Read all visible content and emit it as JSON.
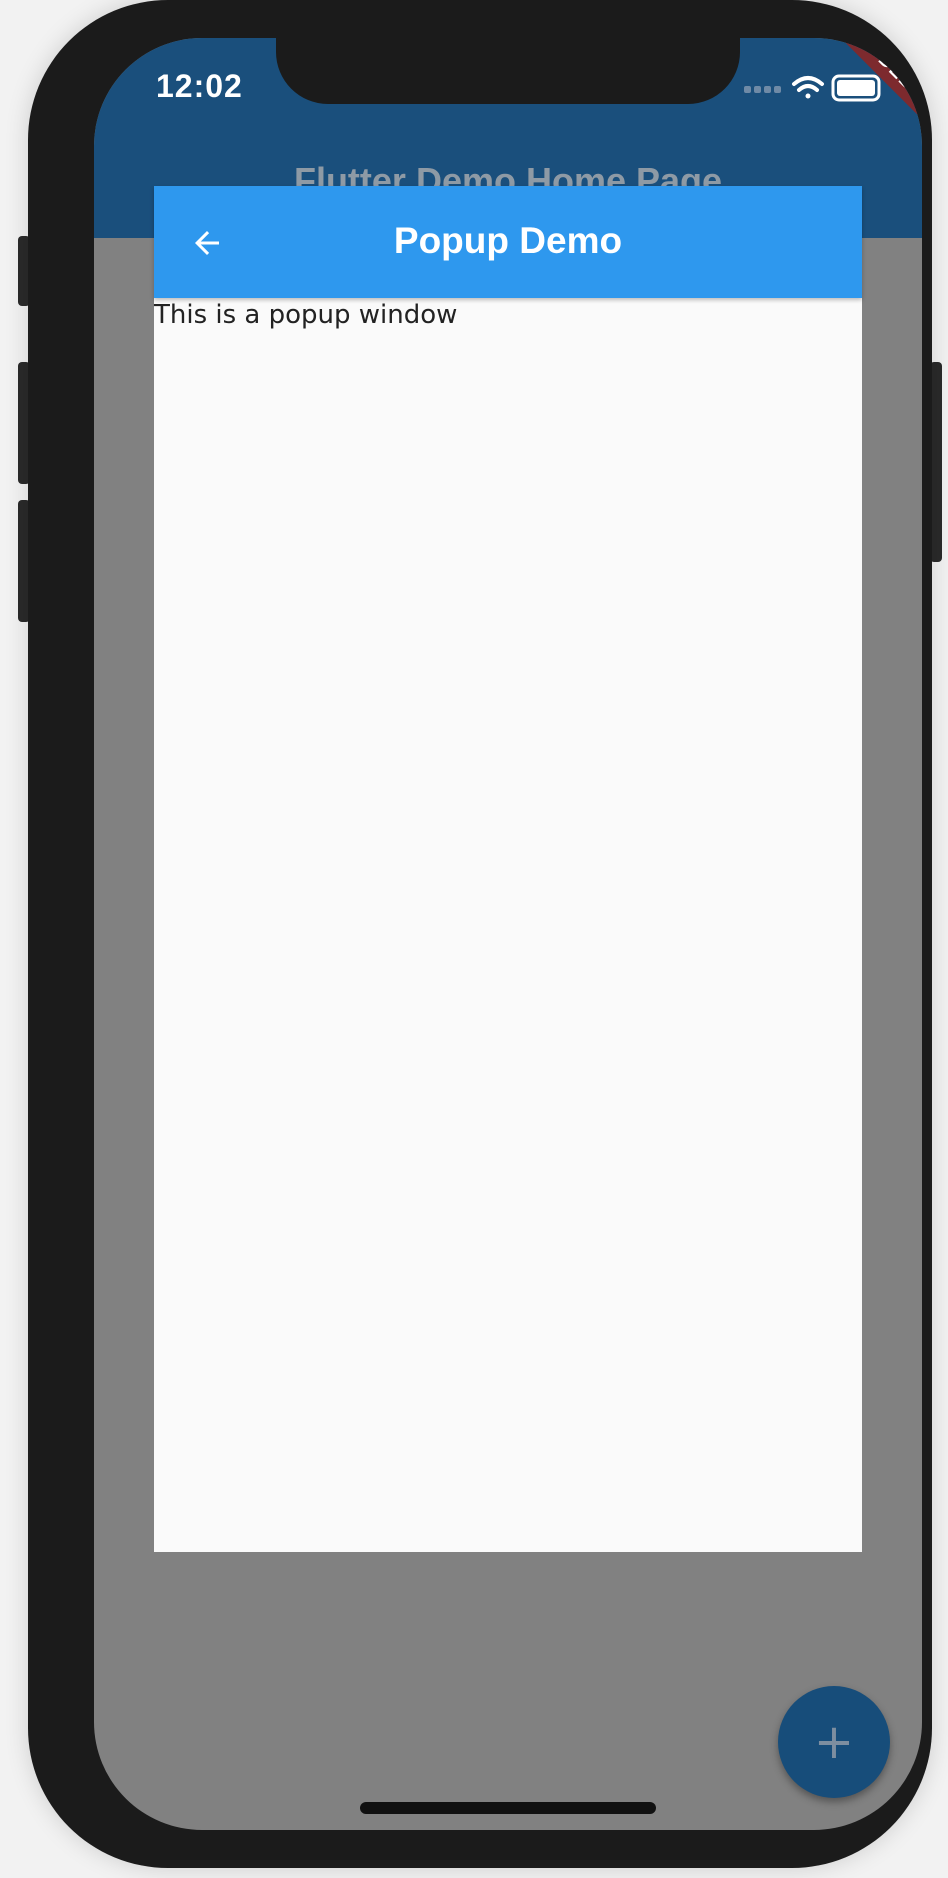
{
  "status_bar": {
    "time": "12:02",
    "icons": [
      "signal-icon",
      "wifi-icon",
      "battery-icon"
    ]
  },
  "debug_banner": "DEBUG",
  "home": {
    "title": "Flutter Demo Home Page",
    "fab_label": "+"
  },
  "popup": {
    "title": "Popup Demo",
    "back_icon": "arrow-back-icon",
    "body_text": "This is a popup window"
  },
  "colors": {
    "home_appbar": "#1a4f7c",
    "popup_appbar": "#2e98ee",
    "scrim": "#818181",
    "fab": "#174d7a",
    "debug_ribbon": "#7d2a2e"
  }
}
